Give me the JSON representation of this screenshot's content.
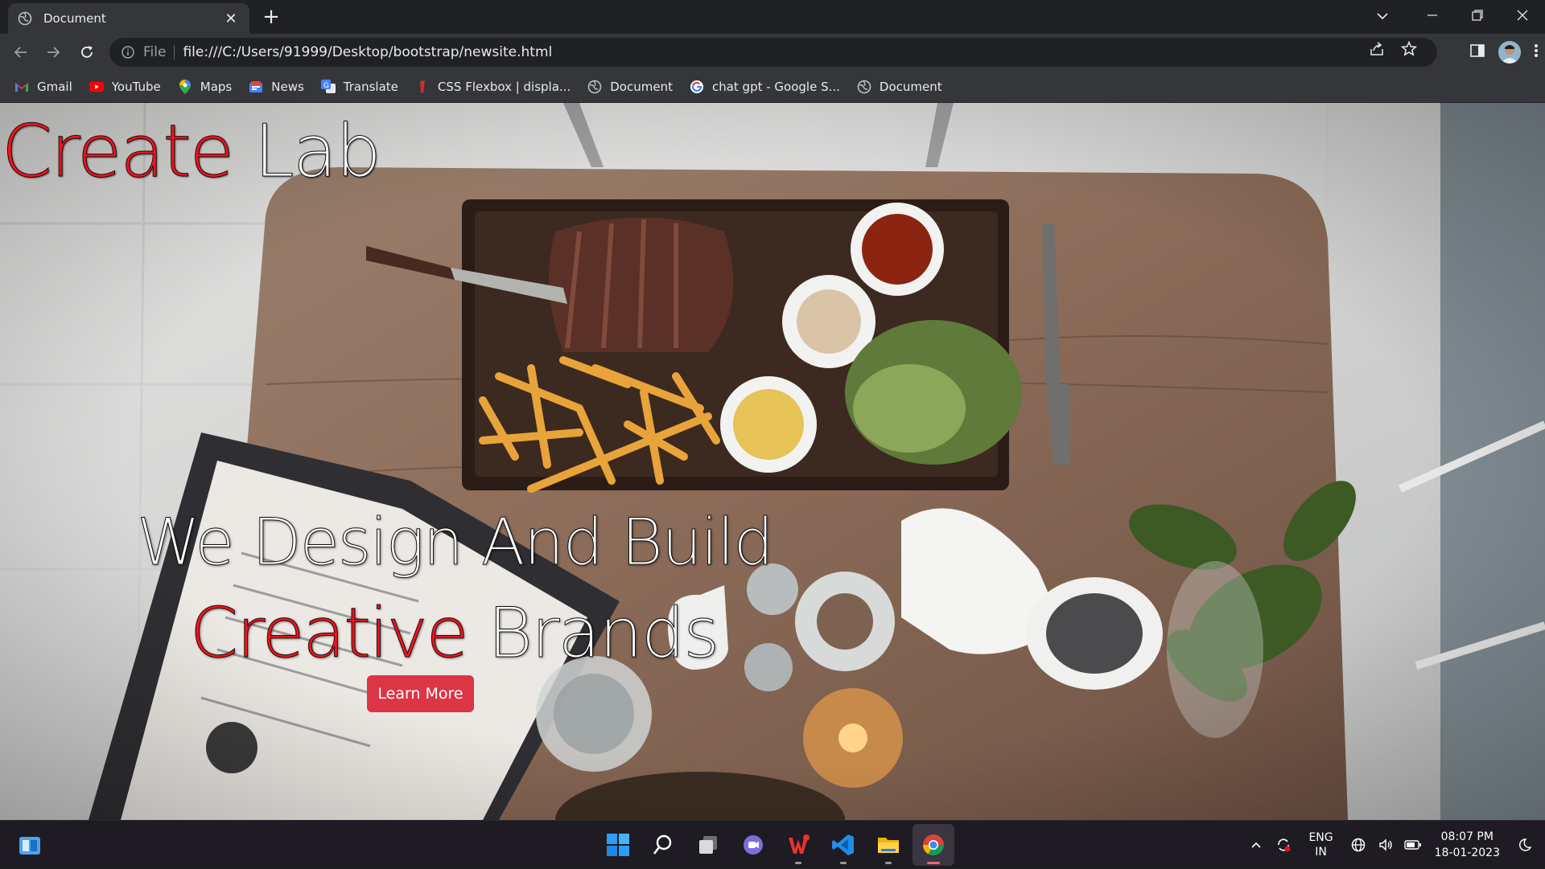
{
  "browser": {
    "tab_title": "Document",
    "address_scheme": "File",
    "address_url": "file:///C:/Users/91999/Desktop/bootstrap/newsite.html",
    "bookmarks": [
      {
        "label": "Gmail",
        "icon": "gmail-icon"
      },
      {
        "label": "YouTube",
        "icon": "youtube-icon"
      },
      {
        "label": "Maps",
        "icon": "maps-icon"
      },
      {
        "label": "News",
        "icon": "news-icon"
      },
      {
        "label": "Translate",
        "icon": "translate-icon"
      },
      {
        "label": "CSS Flexbox | displa...",
        "icon": "css-tricks-icon"
      },
      {
        "label": "Document",
        "icon": "globe-icon"
      },
      {
        "label": "chat gpt - Google S...",
        "icon": "google-icon"
      },
      {
        "label": "Document",
        "icon": "globe-icon"
      }
    ]
  },
  "page": {
    "brand_accent": "Create",
    "brand_rest": " Lab",
    "hero_line1": "We Design And Build",
    "hero_line2_accent": "Creative",
    "hero_line2_rest": " Brands",
    "cta_label": "Learn More",
    "colors": {
      "accent": "#ff0f1a",
      "button": "#dc3545"
    }
  },
  "taskbar": {
    "language_top": "ENG",
    "language_bottom": "IN",
    "time": "08:07 PM",
    "date": "18-01-2023",
    "apps": [
      "start-icon",
      "search-icon",
      "task-view-icon",
      "teams-chat-icon",
      "wps-office-icon",
      "vscode-icon",
      "file-explorer-icon",
      "chrome-icon"
    ]
  }
}
